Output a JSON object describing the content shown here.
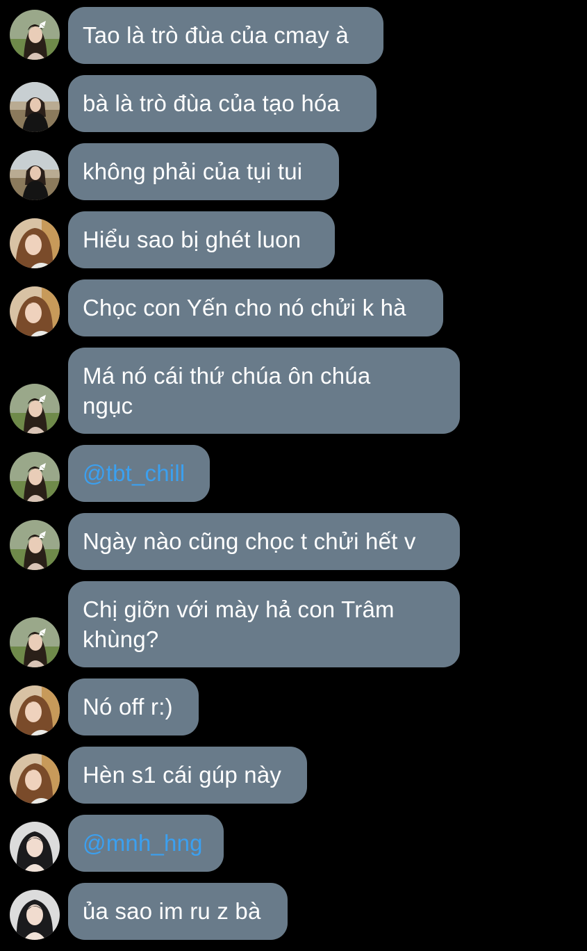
{
  "colors": {
    "background": "#000000",
    "bubble": "#697b8a",
    "message_text": "#ffffff",
    "mention_text": "#3ba0f0"
  },
  "messages": [
    {
      "avatar": "avatar-girl-white-bow-icon",
      "text": "Tao là trò đùa của cmay à"
    },
    {
      "avatar": "avatar-girl-black-jacket-icon",
      "text": "bà là trò đùa của tạo hóa"
    },
    {
      "avatar": "avatar-girl-black-jacket-icon",
      "text": "không phải của tụi tui"
    },
    {
      "avatar": "avatar-girl-brown-hair-icon",
      "text": "Hiểu sao bị ghét luon"
    },
    {
      "avatar": "avatar-girl-brown-hair-icon",
      "text": "Chọc con Yến cho nó chửi k hà"
    },
    {
      "avatar": "avatar-girl-white-bow-icon",
      "text": "Má nó cái thứ chúa ôn chúa\nngục"
    },
    {
      "avatar": "avatar-girl-white-bow-icon",
      "text": "@tbt_chill",
      "mention": true
    },
    {
      "avatar": "avatar-girl-white-bow-icon",
      "text": "Ngày nào cũng chọc t chửi hết v"
    },
    {
      "avatar": "avatar-girl-white-bow-icon",
      "text": "Chị giỡn với mày hả con Trâm\nkhùng?"
    },
    {
      "avatar": "avatar-girl-brown-hair-icon",
      "text": "Nó off r:)"
    },
    {
      "avatar": "avatar-girl-brown-hair-icon",
      "text": "Hèn s1 cái gúp này"
    },
    {
      "avatar": "avatar-girl-dark-hair-icon",
      "text": "@mnh_hng",
      "mention": true
    },
    {
      "avatar": "avatar-girl-dark-hair-icon",
      "text": "ủa sao im ru z bà"
    }
  ]
}
